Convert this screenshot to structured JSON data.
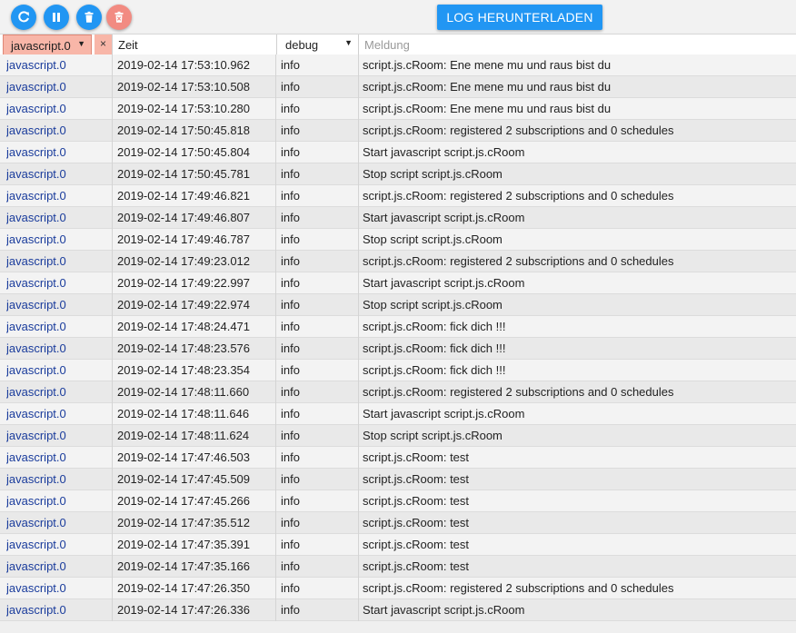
{
  "toolbar": {
    "download_label": "LOG HERUNTERLADEN",
    "colors": {
      "primary": "#2196f3",
      "delete_disabled": "#f28b82"
    }
  },
  "filters": {
    "source_value": "javascript.0",
    "clear_symbol": "×",
    "time_value": "Zeit",
    "level_value": "debug",
    "message_placeholder": "Meldung",
    "arrow_symbol": "▼"
  },
  "rows": [
    {
      "source": "javascript.0",
      "time": "2019-02-14 17:53:10.962",
      "level": "info",
      "message": "script.js.cRoom: Ene mene mu und raus bist du"
    },
    {
      "source": "javascript.0",
      "time": "2019-02-14 17:53:10.508",
      "level": "info",
      "message": "script.js.cRoom: Ene mene mu und raus bist du"
    },
    {
      "source": "javascript.0",
      "time": "2019-02-14 17:53:10.280",
      "level": "info",
      "message": "script.js.cRoom: Ene mene mu und raus bist du"
    },
    {
      "source": "javascript.0",
      "time": "2019-02-14 17:50:45.818",
      "level": "info",
      "message": "script.js.cRoom: registered 2 subscriptions and 0 schedules"
    },
    {
      "source": "javascript.0",
      "time": "2019-02-14 17:50:45.804",
      "level": "info",
      "message": "Start javascript script.js.cRoom"
    },
    {
      "source": "javascript.0",
      "time": "2019-02-14 17:50:45.781",
      "level": "info",
      "message": "Stop script script.js.cRoom"
    },
    {
      "source": "javascript.0",
      "time": "2019-02-14 17:49:46.821",
      "level": "info",
      "message": "script.js.cRoom: registered 2 subscriptions and 0 schedules"
    },
    {
      "source": "javascript.0",
      "time": "2019-02-14 17:49:46.807",
      "level": "info",
      "message": "Start javascript script.js.cRoom"
    },
    {
      "source": "javascript.0",
      "time": "2019-02-14 17:49:46.787",
      "level": "info",
      "message": "Stop script script.js.cRoom"
    },
    {
      "source": "javascript.0",
      "time": "2019-02-14 17:49:23.012",
      "level": "info",
      "message": "script.js.cRoom: registered 2 subscriptions and 0 schedules"
    },
    {
      "source": "javascript.0",
      "time": "2019-02-14 17:49:22.997",
      "level": "info",
      "message": "Start javascript script.js.cRoom"
    },
    {
      "source": "javascript.0",
      "time": "2019-02-14 17:49:22.974",
      "level": "info",
      "message": "Stop script script.js.cRoom"
    },
    {
      "source": "javascript.0",
      "time": "2019-02-14 17:48:24.471",
      "level": "info",
      "message": "script.js.cRoom: fick dich !!!"
    },
    {
      "source": "javascript.0",
      "time": "2019-02-14 17:48:23.576",
      "level": "info",
      "message": "script.js.cRoom: fick dich !!!"
    },
    {
      "source": "javascript.0",
      "time": "2019-02-14 17:48:23.354",
      "level": "info",
      "message": "script.js.cRoom: fick dich !!!"
    },
    {
      "source": "javascript.0",
      "time": "2019-02-14 17:48:11.660",
      "level": "info",
      "message": "script.js.cRoom: registered 2 subscriptions and 0 schedules"
    },
    {
      "source": "javascript.0",
      "time": "2019-02-14 17:48:11.646",
      "level": "info",
      "message": "Start javascript script.js.cRoom"
    },
    {
      "source": "javascript.0",
      "time": "2019-02-14 17:48:11.624",
      "level": "info",
      "message": "Stop script script.js.cRoom"
    },
    {
      "source": "javascript.0",
      "time": "2019-02-14 17:47:46.503",
      "level": "info",
      "message": "script.js.cRoom: test"
    },
    {
      "source": "javascript.0",
      "time": "2019-02-14 17:47:45.509",
      "level": "info",
      "message": "script.js.cRoom: test"
    },
    {
      "source": "javascript.0",
      "time": "2019-02-14 17:47:45.266",
      "level": "info",
      "message": "script.js.cRoom: test"
    },
    {
      "source": "javascript.0",
      "time": "2019-02-14 17:47:35.512",
      "level": "info",
      "message": "script.js.cRoom: test"
    },
    {
      "source": "javascript.0",
      "time": "2019-02-14 17:47:35.391",
      "level": "info",
      "message": "script.js.cRoom: test"
    },
    {
      "source": "javascript.0",
      "time": "2019-02-14 17:47:35.166",
      "level": "info",
      "message": "script.js.cRoom: test"
    },
    {
      "source": "javascript.0",
      "time": "2019-02-14 17:47:26.350",
      "level": "info",
      "message": "script.js.cRoom: registered 2 subscriptions and 0 schedules"
    },
    {
      "source": "javascript.0",
      "time": "2019-02-14 17:47:26.336",
      "level": "info",
      "message": "Start javascript script.js.cRoom"
    }
  ]
}
